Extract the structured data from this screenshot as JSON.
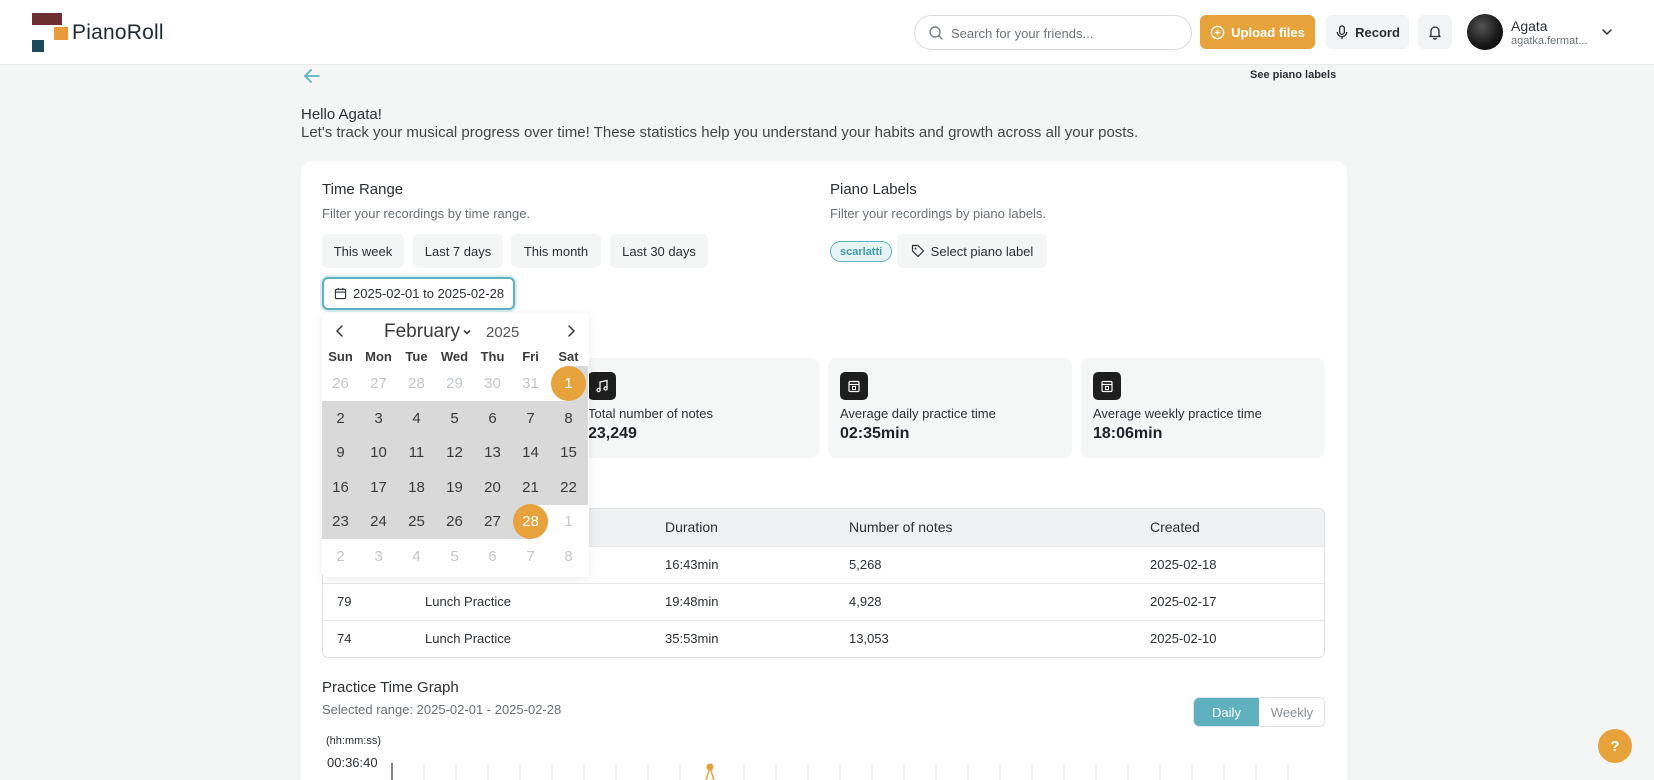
{
  "app": {
    "name": "PianoRoll"
  },
  "header": {
    "search_placeholder": "Search for your friends...",
    "upload_label": "Upload files",
    "record_label": "Record",
    "user_name": "Agata",
    "user_email": "agatka.fermat...",
    "accent": "#e8a23c"
  },
  "page": {
    "see_labels": "See piano labels",
    "hello": "Hello Agata!",
    "intro": "Let's track your musical progress over time! These statistics help you understand your habits and growth across all your posts."
  },
  "time_range": {
    "title": "Time Range",
    "subtitle": "Filter your recordings by time range.",
    "chips": [
      "This week",
      "Last 7 days",
      "This month",
      "Last 30 days"
    ],
    "date_value": "2025-02-01 to 2025-02-28"
  },
  "piano_labels": {
    "title": "Piano Labels",
    "subtitle": "Filter your recordings by piano labels.",
    "badge": "scarlatti",
    "select_label": "Select piano label"
  },
  "stats": [
    {
      "label": "Total number of notes",
      "value": "23,249",
      "icon": "music-note-icon"
    },
    {
      "label": "Average daily practice time",
      "value": "02:35min",
      "icon": "calendar-icon"
    },
    {
      "label": "Average weekly practice time",
      "value": "18:06min",
      "icon": "calendar-icon"
    }
  ],
  "table": {
    "headers": [
      "Duration",
      "Number of notes",
      "Created"
    ],
    "rows": [
      {
        "id": "",
        "name": "",
        "duration": "16:43min",
        "notes": "5,268",
        "created": "2025-02-18"
      },
      {
        "id": "79",
        "name": "Lunch Practice",
        "duration": "19:48min",
        "notes": "4,928",
        "created": "2025-02-17"
      },
      {
        "id": "74",
        "name": "Lunch Practice",
        "duration": "35:53min",
        "notes": "13,053",
        "created": "2025-02-10"
      }
    ]
  },
  "graph": {
    "title": "Practice Time Graph",
    "subtitle": "Selected range: 2025-02-01 - 2025-02-28",
    "daily_label": "Daily",
    "weekly_label": "Weekly",
    "y_unit": "(hh:mm:ss)",
    "y_top": "00:36:40"
  },
  "calendar": {
    "month": "February",
    "year": "2025",
    "weekdays": [
      "Sun",
      "Mon",
      "Tue",
      "Wed",
      "Thu",
      "Fri",
      "Sat"
    ],
    "weeks": [
      [
        "26",
        "27",
        "28",
        "29",
        "30",
        "31",
        "1"
      ],
      [
        "2",
        "3",
        "4",
        "5",
        "6",
        "7",
        "8"
      ],
      [
        "9",
        "10",
        "11",
        "12",
        "13",
        "14",
        "15"
      ],
      [
        "16",
        "17",
        "18",
        "19",
        "20",
        "21",
        "22"
      ],
      [
        "23",
        "24",
        "25",
        "26",
        "27",
        "28",
        "1"
      ],
      [
        "2",
        "3",
        "4",
        "5",
        "6",
        "7",
        "8"
      ]
    ]
  },
  "help": {
    "label": "?"
  }
}
